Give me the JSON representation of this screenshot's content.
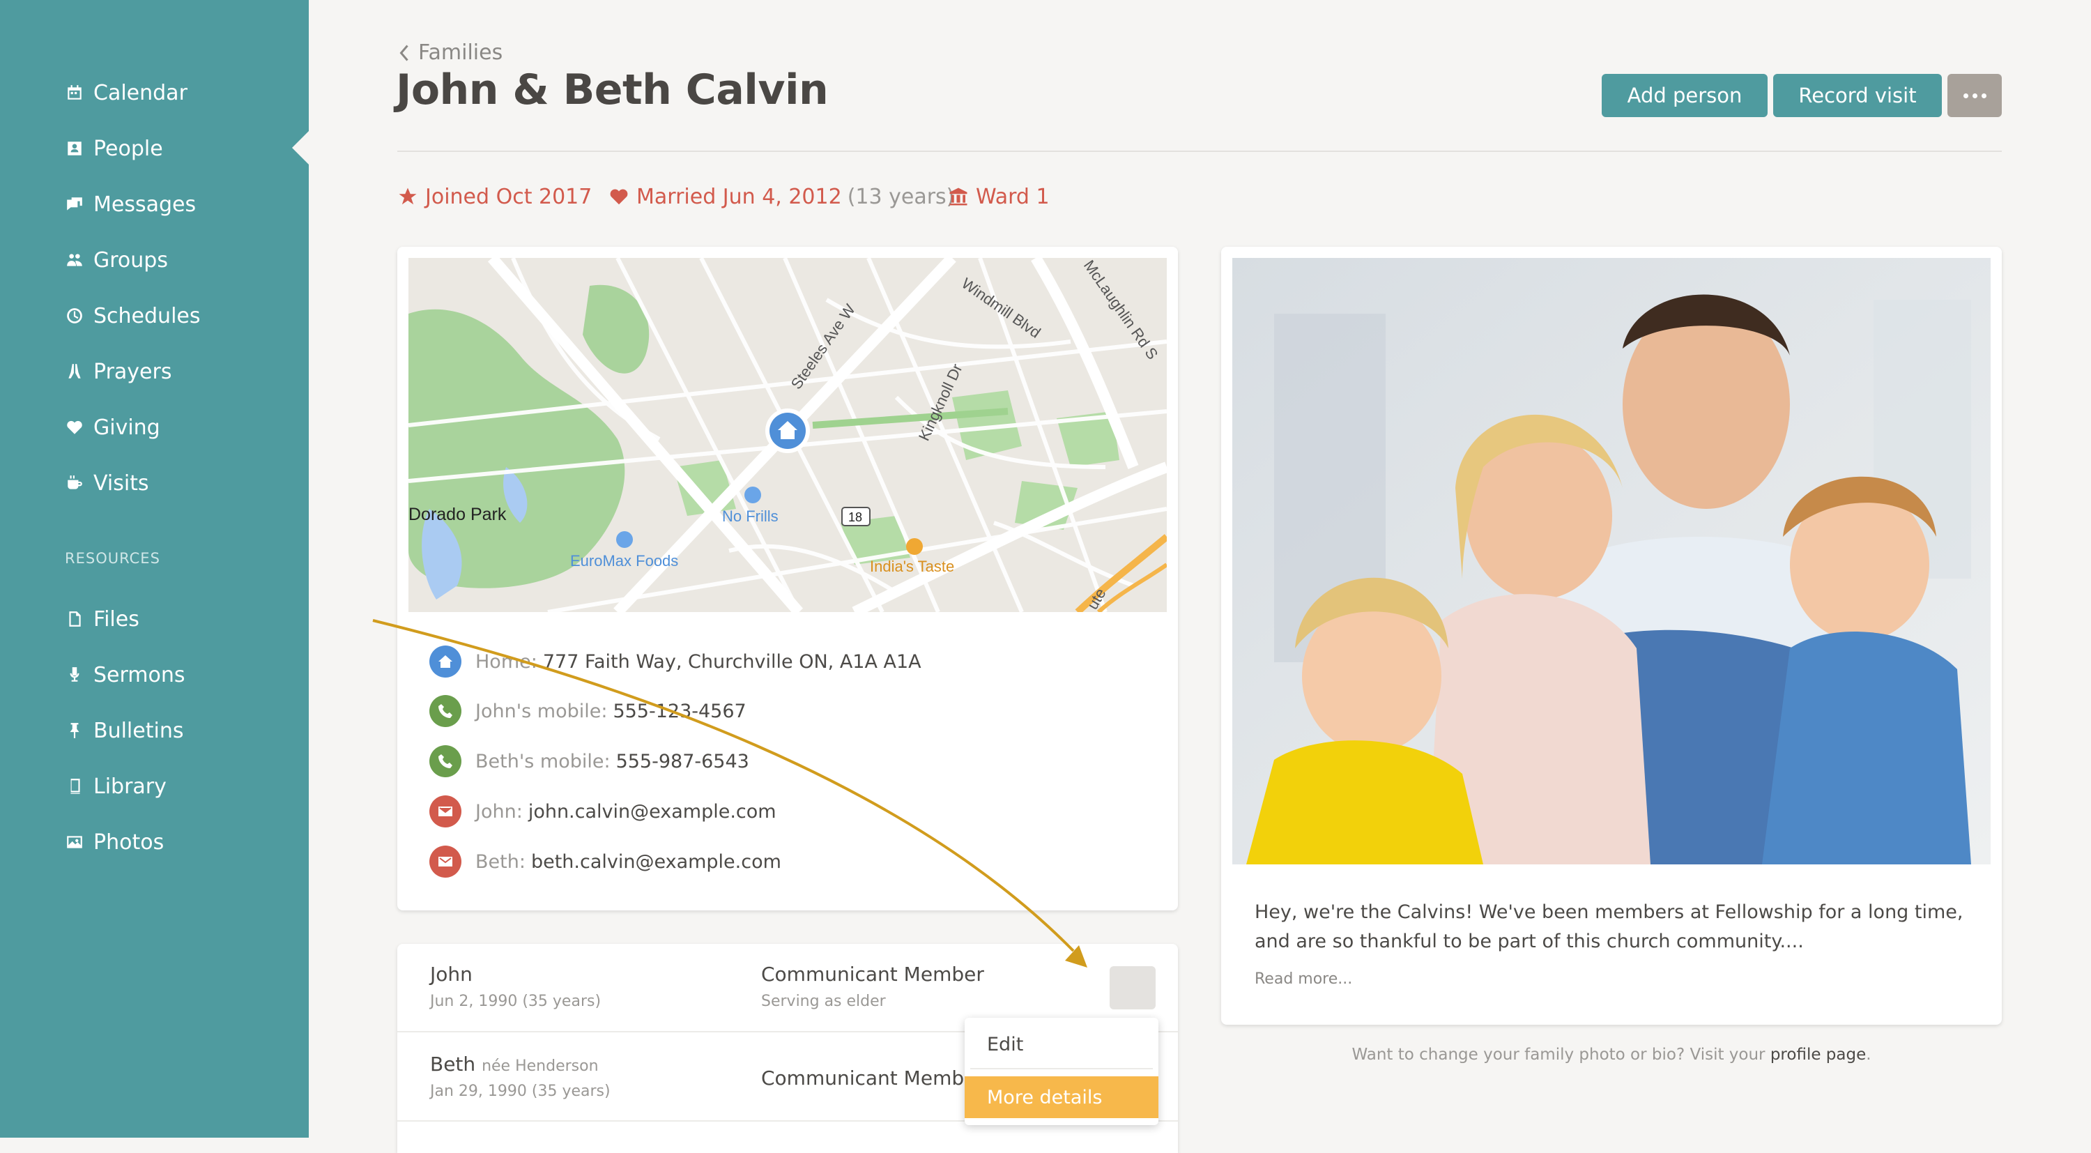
{
  "sidebar": {
    "items": [
      {
        "label": "Calendar",
        "icon": "calendar-icon"
      },
      {
        "label": "People",
        "icon": "people-icon"
      },
      {
        "label": "Messages",
        "icon": "messages-icon"
      },
      {
        "label": "Groups",
        "icon": "groups-icon"
      },
      {
        "label": "Schedules",
        "icon": "clock-icon"
      },
      {
        "label": "Prayers",
        "icon": "praying-hands-icon"
      },
      {
        "label": "Giving",
        "icon": "heart-icon"
      },
      {
        "label": "Visits",
        "icon": "coffee-cup-icon"
      }
    ],
    "section_label": "RESOURCES",
    "resources": [
      {
        "label": "Files",
        "icon": "file-icon"
      },
      {
        "label": "Sermons",
        "icon": "microphone-icon"
      },
      {
        "label": "Bulletins",
        "icon": "pushpin-icon"
      },
      {
        "label": "Library",
        "icon": "book-icon"
      },
      {
        "label": "Photos",
        "icon": "image-icon"
      }
    ]
  },
  "header": {
    "breadcrumb": "Families",
    "title": "John & Beth Calvin",
    "add_person": "Add person",
    "record_visit": "Record visit"
  },
  "meta": {
    "joined": "Joined Oct 2017",
    "married": "Married Jun 4, 2012",
    "married_years": "(13 years)",
    "ward": "Ward 1"
  },
  "map": {
    "labels": [
      "Windmill Blvd",
      "McLaughlin Rd S",
      "Steeles Ave W",
      "Kingknoll Dr",
      "Dorado Park",
      "No Frills",
      "18",
      "EuroMax Foods",
      "India's Taste",
      "ute"
    ]
  },
  "contacts": [
    {
      "label": "Home:",
      "value": "777 Faith Way, Churchville ON, A1A A1A",
      "icon": "home-icon",
      "color": "#4f8fd8"
    },
    {
      "label": "John's mobile:",
      "value": "555-123-4567",
      "icon": "phone-icon",
      "color": "#6a9e4c"
    },
    {
      "label": "Beth's mobile:",
      "value": "555-987-6543",
      "icon": "phone-icon",
      "color": "#6a9e4c"
    },
    {
      "label": "John:",
      "value": "john.calvin@example.com",
      "icon": "email-icon",
      "color": "#d25a4c"
    },
    {
      "label": "Beth:",
      "value": "beth.calvin@example.com",
      "icon": "email-icon",
      "color": "#d25a4c"
    }
  ],
  "members": [
    {
      "name": "John",
      "nee": "",
      "birth": "Jun 2, 1990 (35 years)",
      "role": "Communicant Member",
      "role_sub": "Serving as elder"
    },
    {
      "name": "Beth",
      "nee": "née Henderson",
      "birth": "Jan 29, 1990 (35 years)",
      "role": "Communicant Member",
      "role_sub": ""
    }
  ],
  "dropdown": {
    "edit": "Edit",
    "more_details": "More details"
  },
  "bio": {
    "text": "Hey, we're the Calvins! We've been members at Fellowship for a long time, and are so thankful to be part of this church community....",
    "read_more": "Read more..."
  },
  "footer": {
    "note": "Want to change your family photo or bio? Visit your",
    "link": "profile page",
    "end": "."
  },
  "colors": {
    "sidebar": "#4f9b9f",
    "accent": "#d25a4c",
    "highlight": "#f7b84b",
    "arrow": "#d19c1d"
  }
}
